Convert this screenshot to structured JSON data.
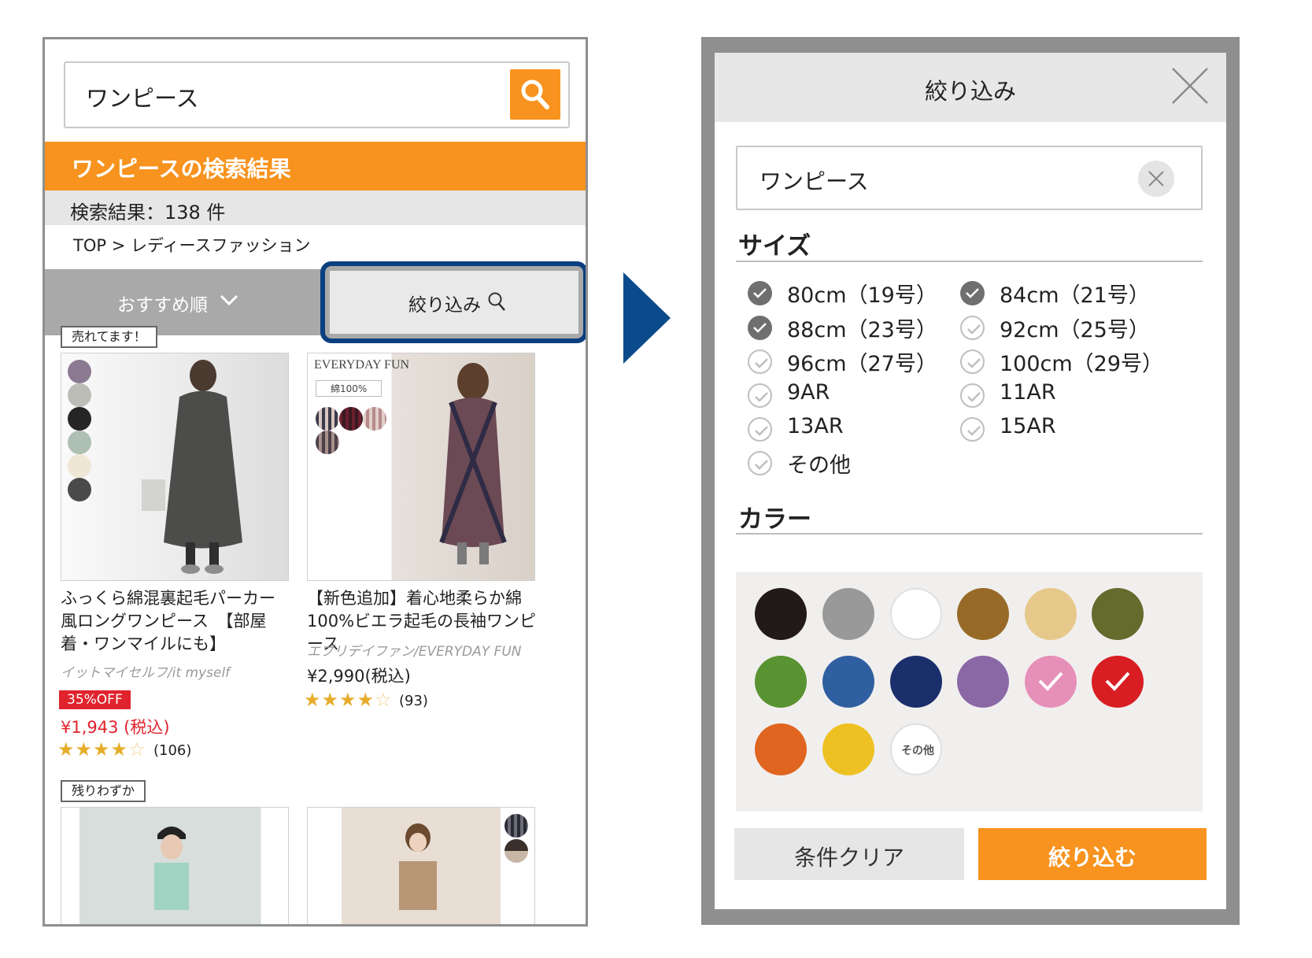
{
  "left": {
    "search_value": "ワンピース",
    "result_heading": "ワンピースの検索結果",
    "result_count": "検索結果：138 件",
    "breadcrumb": "TOP > レディースファッション",
    "sort_label": "おすすめ順",
    "filter_label": "絞り込み",
    "accent_color": "#f7931e",
    "highlight_color": "#0b3f7f",
    "products": [
      {
        "tag": "売れてます！",
        "title": "ふっくら綿混裏起毛パーカー風ロングワンピース　【部屋着・ワンマイルにも】",
        "brand": "イットマイセルフ/it myself",
        "discount": "35%OFF",
        "price": "¥1,943 (税込)",
        "rating": 4,
        "reviews": "(106)",
        "swatches": [
          "#8c7a92",
          "#bdbdb8",
          "#252525",
          "#aebfb4",
          "#efe6d6",
          "#4a4a4a"
        ]
      },
      {
        "brand_logo": "EVERYDAY FUN",
        "material_badge": "綿100%",
        "title": "【新色追加】着心地柔らか綿100%ビエラ起毛の長袖ワンピース",
        "brand": "エブリデイファン/EVERYDAY FUN",
        "price": "¥2,990(税込)",
        "rating": 4,
        "reviews": "(93)"
      }
    ],
    "second_row_tag": "残りわずか"
  },
  "modal": {
    "title": "絞り込み",
    "search_value": "ワンピース",
    "size_heading": "サイズ",
    "sizes": [
      {
        "label": "80cm（19号）",
        "checked": true
      },
      {
        "label": "84cm（21号）",
        "checked": true
      },
      {
        "label": "88cm（23号）",
        "checked": true
      },
      {
        "label": "92cm（25号）",
        "checked": false
      },
      {
        "label": "96cm（27号）",
        "checked": false
      },
      {
        "label": "100cm（29号）",
        "checked": false
      },
      {
        "label": "9AR",
        "checked": false
      },
      {
        "label": "11AR",
        "checked": false
      },
      {
        "label": "13AR",
        "checked": false
      },
      {
        "label": "15AR",
        "checked": false
      },
      {
        "label": "その他",
        "checked": false
      }
    ],
    "color_heading": "カラー",
    "colors": [
      {
        "name": "black",
        "hex": "#211a18",
        "selected": false
      },
      {
        "name": "gray",
        "hex": "#999999",
        "selected": false
      },
      {
        "name": "white",
        "hex": "#ffffff",
        "selected": false
      },
      {
        "name": "brown",
        "hex": "#976b27",
        "selected": false
      },
      {
        "name": "beige",
        "hex": "#e6c88a",
        "selected": false
      },
      {
        "name": "khaki",
        "hex": "#646b2d",
        "selected": false
      },
      {
        "name": "green",
        "hex": "#5a9332",
        "selected": false
      },
      {
        "name": "blue",
        "hex": "#2f5fa1",
        "selected": false
      },
      {
        "name": "navy",
        "hex": "#1a2f6c",
        "selected": false
      },
      {
        "name": "purple",
        "hex": "#8a68a5",
        "selected": false
      },
      {
        "name": "pink",
        "hex": "#e68fb8",
        "selected": true
      },
      {
        "name": "red",
        "hex": "#d81e22",
        "selected": true
      },
      {
        "name": "orange",
        "hex": "#e06520",
        "selected": false
      },
      {
        "name": "yellow",
        "hex": "#edc123",
        "selected": false
      }
    ],
    "color_other_label": "その他",
    "clear_label": "条件クリア",
    "apply_label": "絞り込む"
  }
}
